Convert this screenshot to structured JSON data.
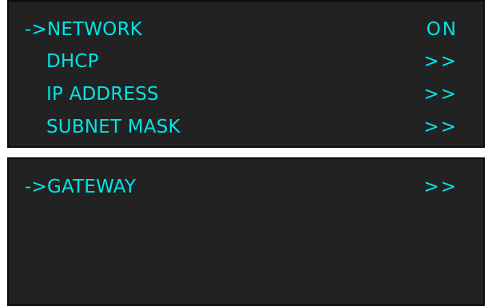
{
  "screen1": {
    "rows": [
      {
        "label": "->NETWORK",
        "value": "ON"
      },
      {
        "label": "DHCP",
        "value": ">>"
      },
      {
        "label": "IP ADDRESS",
        "value": ">>"
      },
      {
        "label": "SUBNET MASK",
        "value": ">>"
      }
    ]
  },
  "screen2": {
    "rows": [
      {
        "label": "->GATEWAY",
        "value": ">>"
      }
    ]
  },
  "colors": {
    "text": "#00E5E5",
    "panel_bg": "#222222",
    "page_bg": "#FFFFFF"
  }
}
